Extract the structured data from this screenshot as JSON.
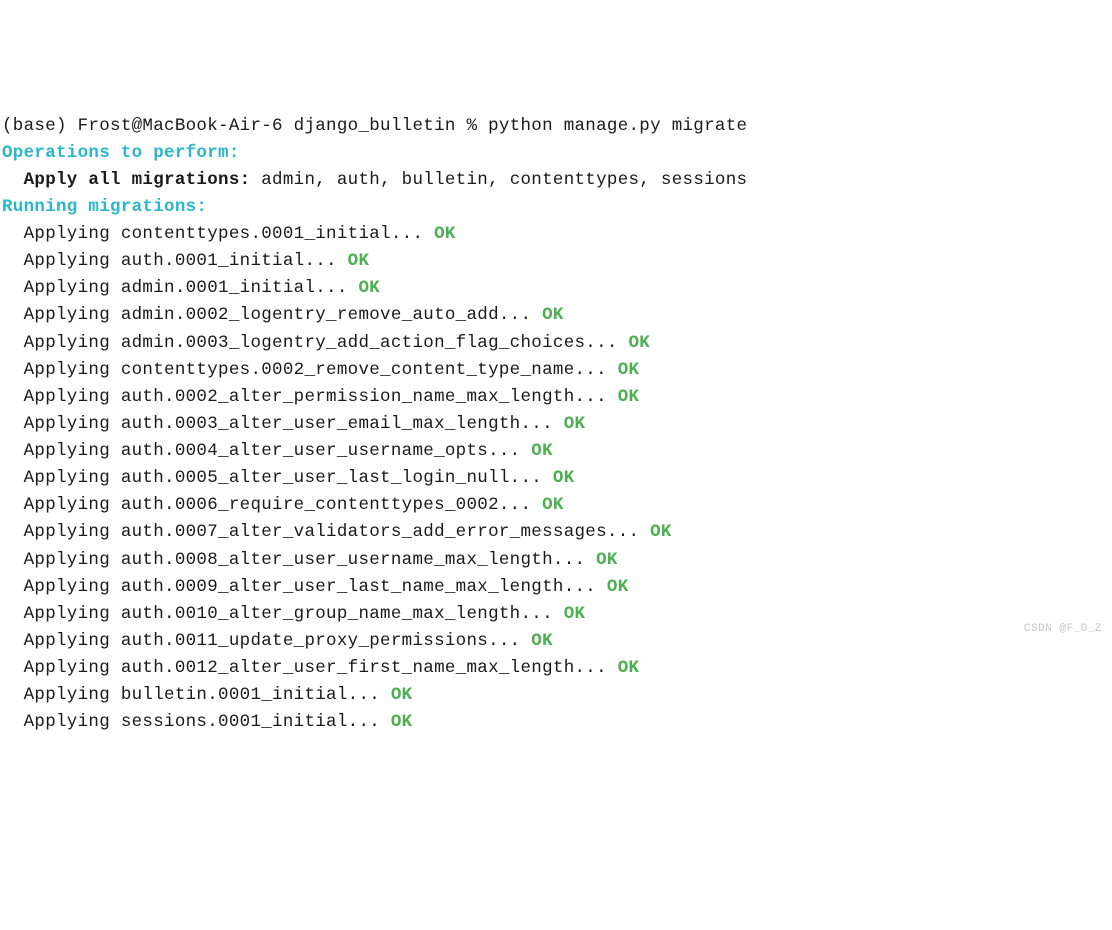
{
  "prompt": "(base) Frost@MacBook-Air-6 django_bulletin % python manage.py migrate",
  "header_operations": "Operations to perform:",
  "apply_all_label": "  Apply all migrations:",
  "apply_all_list": " admin, auth, bulletin, contenttypes, sessions",
  "header_running": "Running migrations:",
  "applying_prefix": "  Applying ",
  "dots": "...",
  "ok_suffix": " OK",
  "migrations": [
    "contenttypes.0001_initial",
    "auth.0001_initial",
    "admin.0001_initial",
    "admin.0002_logentry_remove_auto_add",
    "admin.0003_logentry_add_action_flag_choices",
    "contenttypes.0002_remove_content_type_name",
    "auth.0002_alter_permission_name_max_length",
    "auth.0003_alter_user_email_max_length",
    "auth.0004_alter_user_username_opts",
    "auth.0005_alter_user_last_login_null",
    "auth.0006_require_contenttypes_0002",
    "auth.0007_alter_validators_add_error_messages",
    "auth.0008_alter_user_username_max_length",
    "auth.0009_alter_user_last_name_max_length",
    "auth.0010_alter_group_name_max_length",
    "auth.0011_update_proxy_permissions",
    "auth.0012_alter_user_first_name_max_length",
    "bulletin.0001_initial",
    "sessions.0001_initial"
  ],
  "watermark": "CSDN @F_D_Z"
}
